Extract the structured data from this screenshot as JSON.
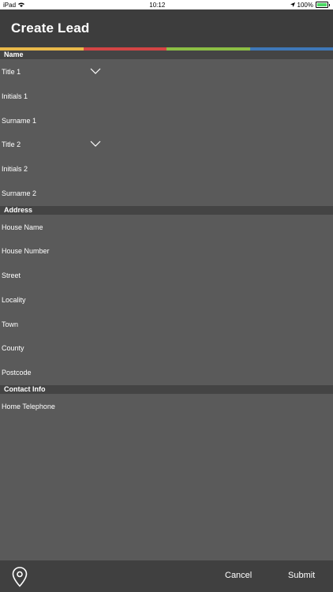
{
  "status_bar": {
    "device": "iPad",
    "time": "10:12",
    "battery": "100%"
  },
  "header": {
    "title": "Create Lead"
  },
  "strip_colors": [
    "#e8b84a",
    "#d34545",
    "#8cbf45",
    "#3f78b8"
  ],
  "sections": {
    "name": {
      "title": "Name",
      "fields": [
        "Title 1",
        "Initials 1",
        "Surname 1",
        "Title 2",
        "Initials 2",
        "Surname 2"
      ]
    },
    "address": {
      "title": "Address",
      "fields": [
        "House Name",
        "House Number",
        "Street",
        "Locality",
        "Town",
        "County",
        "Postcode"
      ]
    },
    "contact": {
      "title": "Contact Info",
      "fields": [
        "Home Telephone"
      ]
    }
  },
  "bottom_bar": {
    "cancel_label": "Cancel",
    "submit_label": "Submit"
  }
}
